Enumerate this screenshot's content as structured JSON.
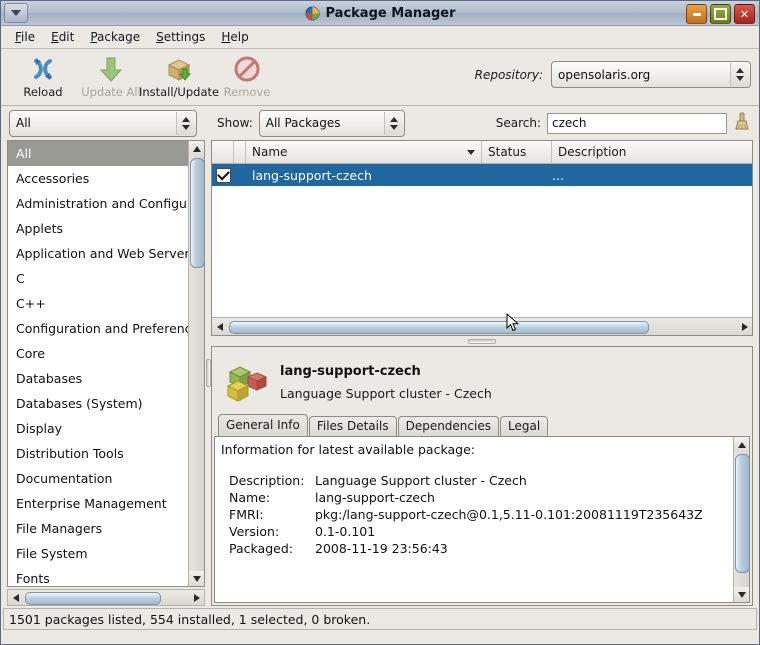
{
  "window": {
    "title": "Package Manager",
    "title_icon": "package-globe-icon",
    "menu_button_icon": "window-menu-icon",
    "minimize_icon": "minimize-icon",
    "maximize_icon": "maximize-icon",
    "close_icon": "close-icon"
  },
  "menubar": {
    "items": [
      {
        "label": "File",
        "mnemonic": "F"
      },
      {
        "label": "Edit",
        "mnemonic": "E"
      },
      {
        "label": "Package",
        "mnemonic": "P"
      },
      {
        "label": "Settings",
        "mnemonic": "S"
      },
      {
        "label": "Help",
        "mnemonic": "H"
      }
    ]
  },
  "toolbar": {
    "buttons": [
      {
        "label": "Reload",
        "icon": "reload-icon",
        "enabled": true
      },
      {
        "label": "Update All",
        "icon": "update-all-icon",
        "enabled": false
      },
      {
        "label": "Install/Update",
        "icon": "install-update-icon",
        "enabled": true
      },
      {
        "label": "Remove",
        "icon": "remove-icon",
        "enabled": false
      }
    ],
    "repository_label": "Repository:",
    "repository_value": "opensolaris.org"
  },
  "filters": {
    "category_value": "All",
    "show_label": "Show:",
    "show_value": "All Packages",
    "search_label": "Search:",
    "search_value": "czech",
    "search_placeholder": "",
    "clear_icon": "broom-clear-icon"
  },
  "sidebar": {
    "items": [
      {
        "label": "All",
        "selected": true
      },
      {
        "label": "Accessories",
        "selected": false
      },
      {
        "label": "Administration and Configuratio",
        "selected": false
      },
      {
        "label": "Applets",
        "selected": false
      },
      {
        "label": "Application and Web Servers",
        "selected": false
      },
      {
        "label": "C",
        "selected": false
      },
      {
        "label": "C++",
        "selected": false
      },
      {
        "label": "Configuration and Preferences",
        "selected": false
      },
      {
        "label": "Core",
        "selected": false
      },
      {
        "label": "Databases",
        "selected": false
      },
      {
        "label": "Databases (System)",
        "selected": false
      },
      {
        "label": "Display",
        "selected": false
      },
      {
        "label": "Distribution Tools",
        "selected": false
      },
      {
        "label": "Documentation",
        "selected": false
      },
      {
        "label": "Enterprise Management",
        "selected": false
      },
      {
        "label": "File Managers",
        "selected": false
      },
      {
        "label": "File System",
        "selected": false
      },
      {
        "label": "Fonts",
        "selected": false
      }
    ]
  },
  "package_table": {
    "columns": [
      "",
      "",
      "Name",
      "Status",
      "Description"
    ],
    "sort_column": "Name",
    "rows": [
      {
        "checked": true,
        "name": "lang-support-czech",
        "status": "",
        "description": "...",
        "selected": true
      }
    ]
  },
  "detail": {
    "package_icon": "package-cubes-icon",
    "title": "lang-support-czech",
    "subtitle": "Language Support cluster - Czech",
    "tabs": [
      {
        "label": "General Info",
        "active": true
      },
      {
        "label": "Files Details",
        "active": false
      },
      {
        "label": "Dependencies",
        "active": false
      },
      {
        "label": "Legal",
        "active": false
      }
    ],
    "info_heading": "Information for latest available package:",
    "fields": [
      {
        "key": "Description:",
        "value": "Language Support cluster - Czech"
      },
      {
        "key": "Name:",
        "value": "lang-support-czech"
      },
      {
        "key": "FMRI:",
        "value": "pkg:/lang-support-czech@0.1,5.11-0.101:20081119T235643Z"
      },
      {
        "key": "Version:",
        "value": "0.1-0.101"
      },
      {
        "key": "Packaged:",
        "value": "2008-11-19 23:56:43"
      }
    ]
  },
  "statusbar": {
    "text": "1501 packages listed, 554 installed, 1 selected, 0 broken."
  },
  "colors": {
    "selection_blue": "#1f679e",
    "window_chrome": "#ece9e4",
    "titlebar": "#b2bdcd"
  }
}
